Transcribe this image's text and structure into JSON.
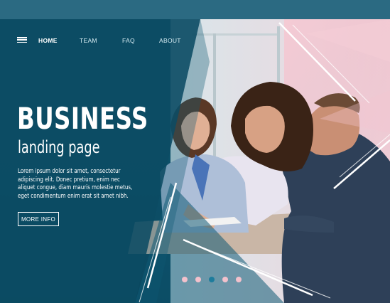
{
  "nav": {
    "items": [
      {
        "label": "HOME",
        "active": true
      },
      {
        "label": "TEAM",
        "active": false
      },
      {
        "label": "FAQ",
        "active": false
      },
      {
        "label": "ABOUT",
        "active": false
      }
    ],
    "menu_icon": "hamburger-icon"
  },
  "hero": {
    "title": "BUSINESS",
    "subtitle": "landing page",
    "body_lines": [
      "Lorem ipsum dolor sit amet, consectetur",
      "adipiscing elit. Donec pretium, enim nec",
      "aliquet congue, diam mauris molestie metus,",
      "eget condimentum enim erat sit amet nibh."
    ],
    "button_label": "MORE INFO"
  },
  "carousel": {
    "slide_count": 5,
    "active_index": 2
  },
  "colors": {
    "teal_overlay": "#0c4a62",
    "accent_pink": "#f3c1cc",
    "active_dot": "#1e7c9c",
    "text": "#ffffff"
  }
}
